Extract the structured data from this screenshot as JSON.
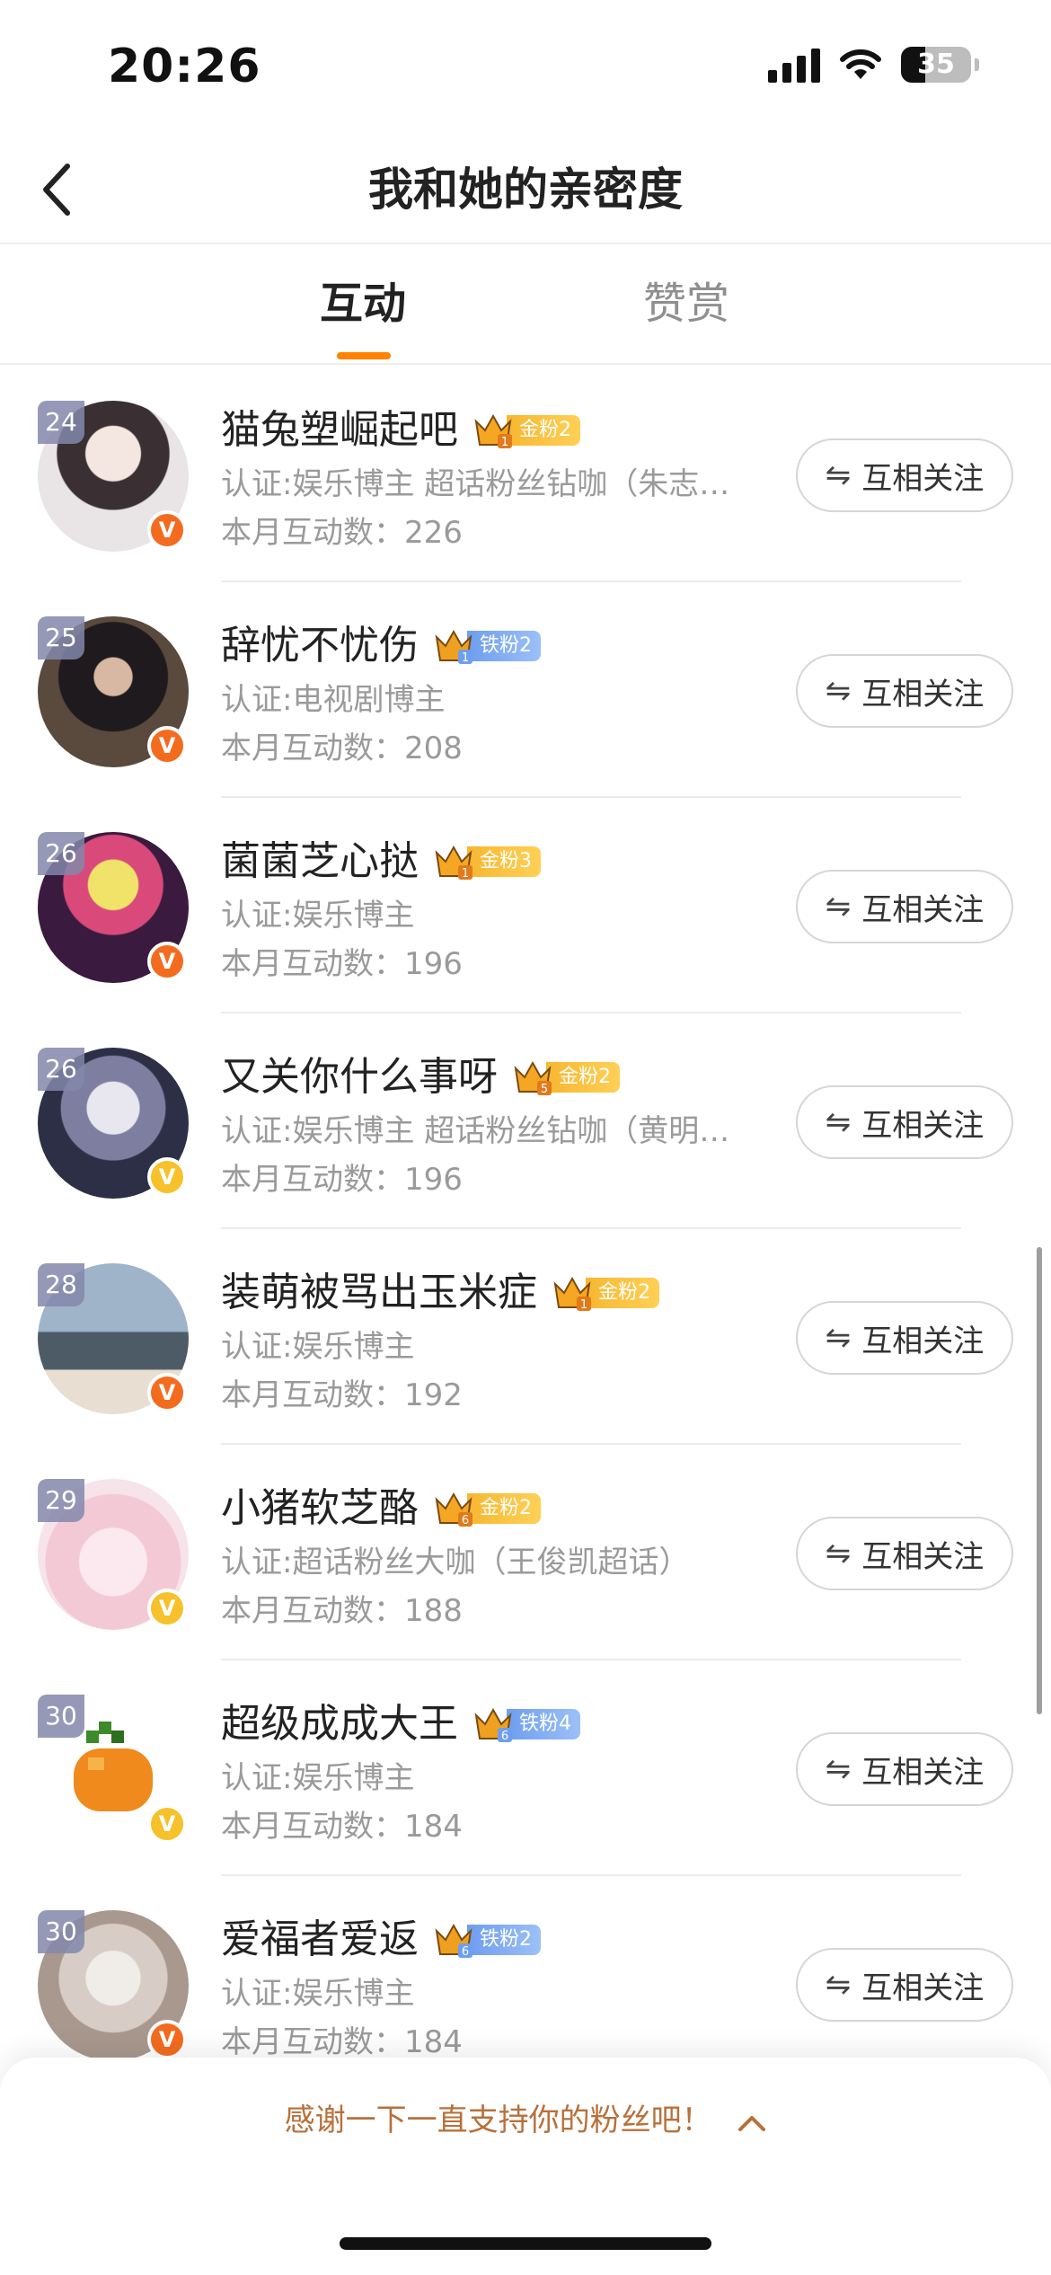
{
  "status_bar": {
    "time": "20:26",
    "battery": "35"
  },
  "nav": {
    "title": "我和她的亲密度"
  },
  "tabs": [
    {
      "label": "互动",
      "active": true
    },
    {
      "label": "赞赏",
      "active": false
    }
  ],
  "follow_label": "互相关注",
  "swap_icon": "⇋",
  "colors": {
    "accent": "#ff8200",
    "gold_tag": "#f7b731",
    "iron_tag": "#6e9ef0",
    "thanks_text": "#b8703a"
  },
  "rows": [
    {
      "rank": "24",
      "name": "猫兔塑崛起吧",
      "badge_level": "1",
      "badge_tag": "金粉2",
      "badge_kind": "gold",
      "cert": "认证:娱乐博主 超话粉丝钻咖（朱志…",
      "count": "本月互动数：226",
      "verified": "orange"
    },
    {
      "rank": "25",
      "name": "辞忧不忧伤",
      "badge_level": "1",
      "badge_tag": "铁粉2",
      "badge_kind": "iron",
      "cert": "认证:电视剧博主",
      "count": "本月互动数：208",
      "verified": "orange"
    },
    {
      "rank": "26",
      "name": "菌菌芝心挞",
      "badge_level": "1",
      "badge_tag": "金粉3",
      "badge_kind": "gold",
      "cert": "认证:娱乐博主",
      "count": "本月互动数：196",
      "verified": "orange"
    },
    {
      "rank": "26",
      "name": "又关你什么事呀",
      "badge_level": "5",
      "badge_tag": "金粉2",
      "badge_kind": "gold",
      "cert": "认证:娱乐博主 超话粉丝钻咖（黄明…",
      "count": "本月互动数：196",
      "verified": "yellow"
    },
    {
      "rank": "28",
      "name": "装萌被骂出玉米症",
      "badge_level": "1",
      "badge_tag": "金粉2",
      "badge_kind": "gold",
      "cert": "认证:娱乐博主",
      "count": "本月互动数：192",
      "verified": "orange"
    },
    {
      "rank": "29",
      "name": "小猪软芝酪",
      "badge_level": "6",
      "badge_tag": "金粉2",
      "badge_kind": "gold",
      "cert": "认证:超话粉丝大咖（王俊凯超话）",
      "count": "本月互动数：188",
      "verified": "yellow"
    },
    {
      "rank": "30",
      "name": "超级成成大王",
      "badge_level": "6",
      "badge_tag": "铁粉4",
      "badge_kind": "iron",
      "cert": "认证:娱乐博主",
      "count": "本月互动数：184",
      "verified": "yellow"
    },
    {
      "rank": "30",
      "name": "爱福者爱返",
      "badge_level": "6",
      "badge_tag": "铁粉2",
      "badge_kind": "iron",
      "cert": "认证:娱乐博主",
      "count": "本月互动数：184",
      "verified": "orange"
    }
  ],
  "footer": {
    "thanks": "感谢一下一直支持你的粉丝吧！"
  }
}
